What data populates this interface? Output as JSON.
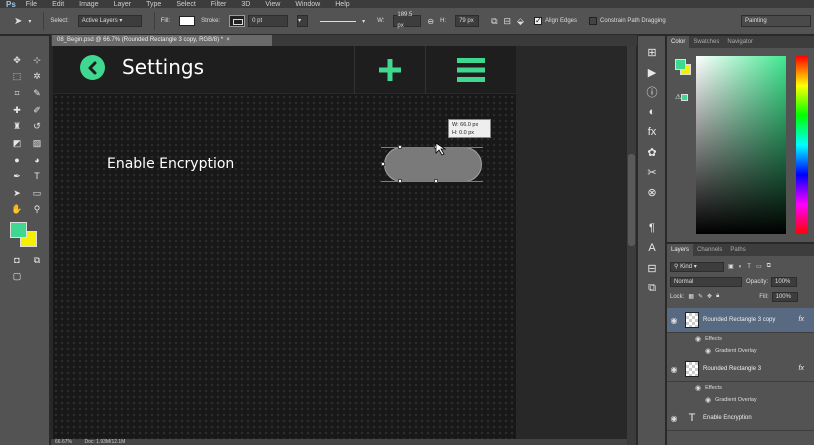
{
  "app": {
    "logo": "Ps",
    "menu": [
      "File",
      "Edit",
      "Image",
      "Layer",
      "Type",
      "Select",
      "Filter",
      "3D",
      "View",
      "Window",
      "Help"
    ]
  },
  "options": {
    "select_label": "Select:",
    "select_value": "Active Layers",
    "fill_label": "Fill:",
    "stroke_label": "Stroke:",
    "stroke_size": "0 pt",
    "w_label": "W:",
    "w_value": "189.5 px",
    "h_label": "H:",
    "h_value": "79 px",
    "align_edges": "Align Edges",
    "constrain": "Constrain Path Dragging",
    "workspace": "Painting"
  },
  "document": {
    "tab_title": "08_Begin.psd @ 66.7% (Rounded Rectangle 3 copy, RGB/8) *",
    "zoom": "66.67%",
    "doc_info": "Doc: 1.93M/12.1M"
  },
  "design": {
    "title": "Settings",
    "setting_label": "Enable Encryption",
    "tooltip_w": "W:   66.0 px",
    "tooltip_h": "H:    0.0 px",
    "accent": "#40d890",
    "toggle_color": "#7a7a7a"
  },
  "colors": {
    "foreground": "#40d890",
    "background": "#f4f000"
  },
  "color_panel": {
    "tabs": [
      "Color",
      "Swatches",
      "Navigator"
    ]
  },
  "layers_panel": {
    "tabs": [
      "Layers",
      "Channels",
      "Paths"
    ],
    "kind": "Kind",
    "blend_mode": "Normal",
    "opacity_label": "Opacity:",
    "opacity_value": "100%",
    "lock_label": "Lock:",
    "fill_label": "Fill:",
    "fill_value": "100%",
    "layers": [
      {
        "name": "Rounded Rectangle 3 copy",
        "effects": "Effects",
        "effect": "Gradient Overlay",
        "fx": "fx"
      },
      {
        "name": "Rounded Rectangle 3",
        "effects": "Effects",
        "effect": "Gradient Overlay",
        "fx": "fx"
      },
      {
        "name": "Enable Encryption",
        "type_glyph": "T"
      }
    ]
  }
}
